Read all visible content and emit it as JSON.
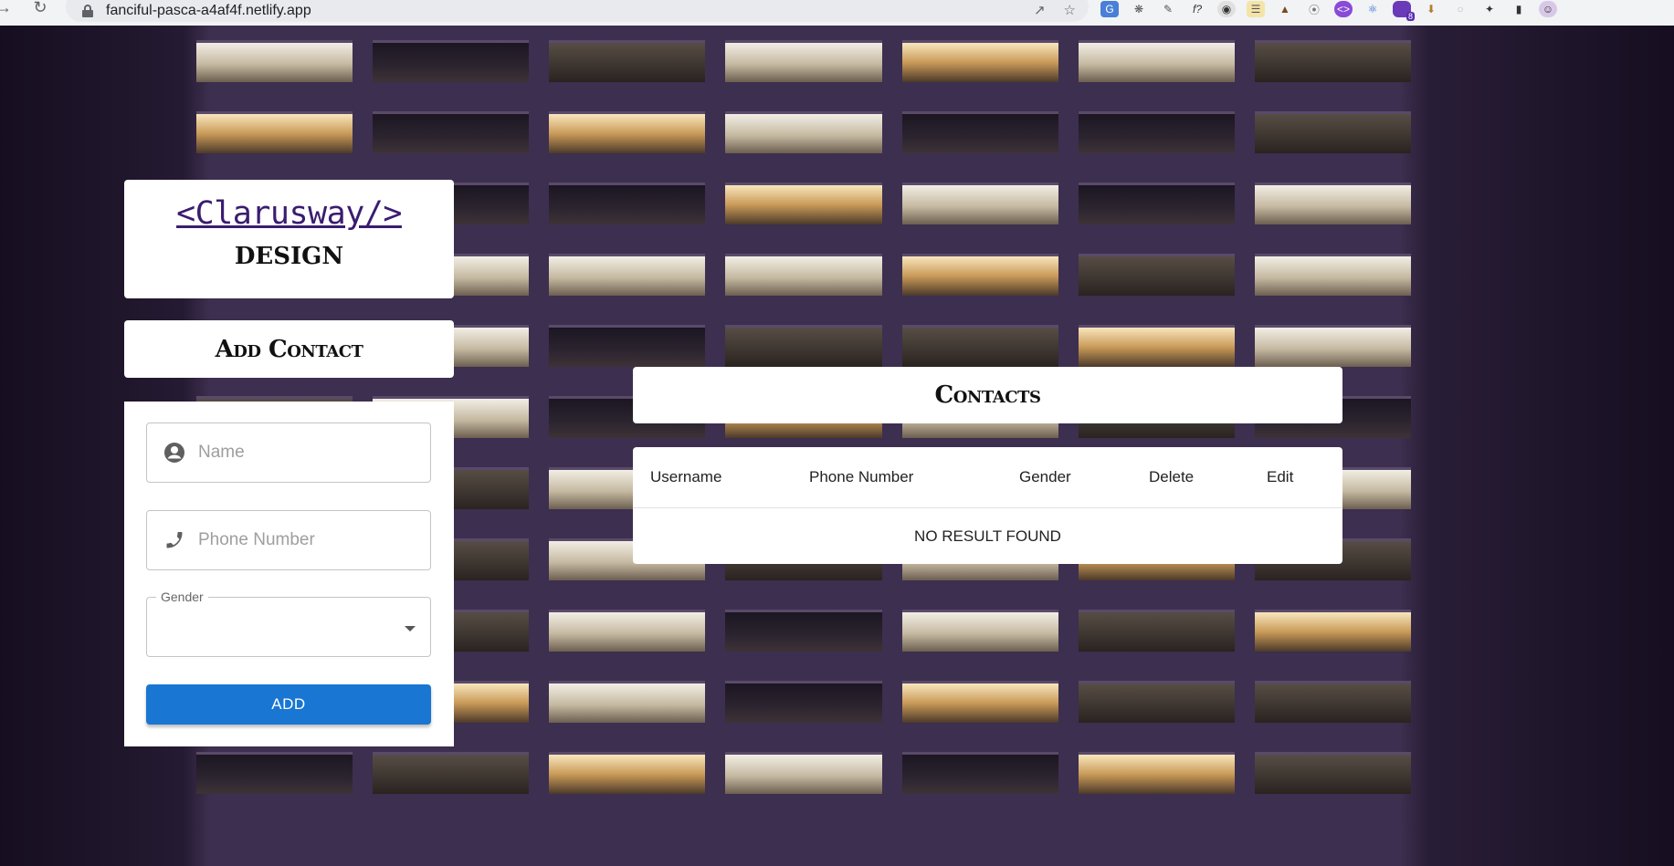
{
  "browser": {
    "url": "fanciful-pasca-a4af4f.netlify.app",
    "extension_badge": "8"
  },
  "brand": {
    "logo_text": "<Clarusway/>",
    "subtitle": "DESIGN"
  },
  "add_contact": {
    "title": "Add Contact",
    "name_placeholder": "Name",
    "phone_placeholder": "Phone Number",
    "gender_label": "Gender",
    "gender_value": "",
    "add_button": "ADD"
  },
  "contacts": {
    "title": "Contacts",
    "columns": [
      "Username",
      "Phone Number",
      "Gender",
      "Delete",
      "Edit"
    ],
    "empty_message": "NO RESULT FOUND"
  },
  "colors": {
    "primary_button": "#1976d2",
    "logo_link": "#3a1c70"
  }
}
